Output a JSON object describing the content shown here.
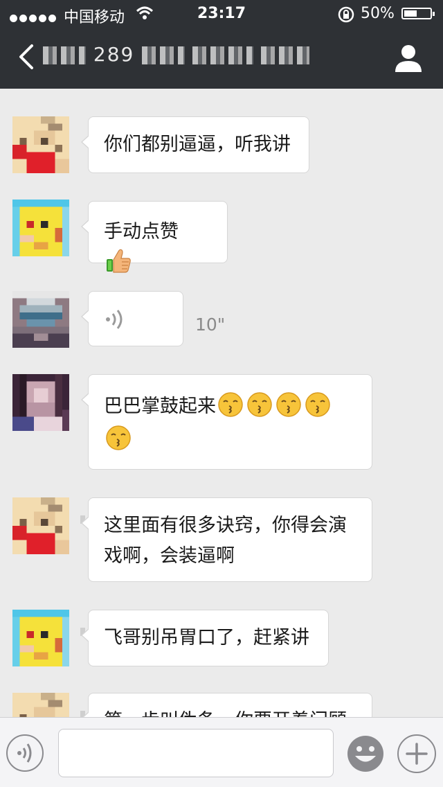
{
  "status": {
    "carrier": "中国移动",
    "time": "23:17",
    "battery": "50%",
    "battery_level": 0.5
  },
  "header": {
    "title_visible": "289"
  },
  "messages": [
    {
      "text": "你们都别逼逼，听我讲"
    },
    {
      "text": "手动点赞"
    },
    {
      "voice_duration": "10\""
    },
    {
      "line1": "巴巴掌鼓起来",
      "emoji_count": 5
    },
    {
      "line1": "这里面有很多诀窍，你得会演",
      "line2": "戏啊，会装逼啊"
    },
    {
      "text": "飞哥别吊胃口了，赶紧讲"
    },
    {
      "partial": "第一步叫伪条，你要开着门顾"
    }
  ],
  "icons": {
    "back": "back-chevron-icon",
    "contact": "person-icon",
    "wifi": "wifi-icon",
    "lock": "rotation-lock-icon",
    "voice": "voice-icon",
    "emoji": "smiley-icon",
    "plus": "plus-icon",
    "thumbs": "thumbs-up-emoji",
    "kiss": "kissing-face-emoji"
  },
  "colors": {
    "bar": "#2e3135",
    "background": "#ebebeb",
    "bubble": "#ffffff",
    "border": "#d6d6d6"
  }
}
